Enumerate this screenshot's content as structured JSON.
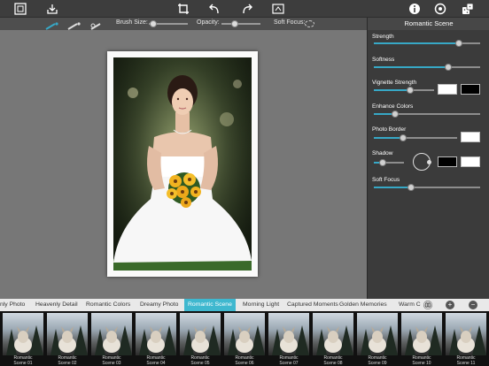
{
  "toolbar": {
    "icons": [
      "frame-icon",
      "open-tray-icon",
      "crop-icon",
      "undo-icon",
      "redo-icon",
      "compare-icon",
      "info-icon",
      "settings-icon",
      "random-dice-icon"
    ]
  },
  "subbar": {
    "brush_size_label": "Brush Size:",
    "opacity_label": "Opacity:",
    "soft_focus_label": "Soft Focus:",
    "brush_size_value": 0.12,
    "opacity_value": 0.35
  },
  "panel": {
    "title": "Romantic Scene",
    "controls": [
      {
        "label": "Strength",
        "value": 0.8
      },
      {
        "label": "Softness",
        "value": 0.7
      },
      {
        "label": "Vignette Strength",
        "value": 0.6
      },
      {
        "label": "Enhance Colors",
        "value": 0.2
      },
      {
        "label": "Photo Border",
        "value": 0.35
      },
      {
        "label": "Shadow",
        "value": 0.3
      },
      {
        "label": "Soft Focus",
        "value": 0.35
      }
    ],
    "swatch_colors": {
      "vignette_light": "#ffffff",
      "vignette_dark": "#000000",
      "border": "#ffffff",
      "shadow_dark": "#000000",
      "shadow_light": "#ffffff"
    },
    "accent": "#37a8c6"
  },
  "tabs": {
    "items": [
      "nly Photo",
      "Heavenly Detail",
      "Romantic Colors",
      "Dreamy Photo",
      "Romantic Scene",
      "Morning Light",
      "Captured Moments",
      "Golden Memories",
      "Warm C"
    ],
    "active": "Romantic Scene",
    "buttons": [
      "",
      "+",
      "−"
    ]
  },
  "thumbnails": [
    {
      "line1": "Romantic",
      "line2": "Scene 01"
    },
    {
      "line1": "Romantic",
      "line2": "Scene 02"
    },
    {
      "line1": "Romantic",
      "line2": "Scene 03"
    },
    {
      "line1": "Romantic",
      "line2": "Scene 04"
    },
    {
      "line1": "Romantic",
      "line2": "Scene 05"
    },
    {
      "line1": "Romantic",
      "line2": "Scene 06"
    },
    {
      "line1": "Romantic",
      "line2": "Scene 07"
    },
    {
      "line1": "Romantic",
      "line2": "Scene 08"
    },
    {
      "line1": "Romantic",
      "line2": "Scene 09"
    },
    {
      "line1": "Romantic",
      "line2": "Scene 10"
    },
    {
      "line1": "Romantic",
      "line2": "Scene 11"
    }
  ]
}
